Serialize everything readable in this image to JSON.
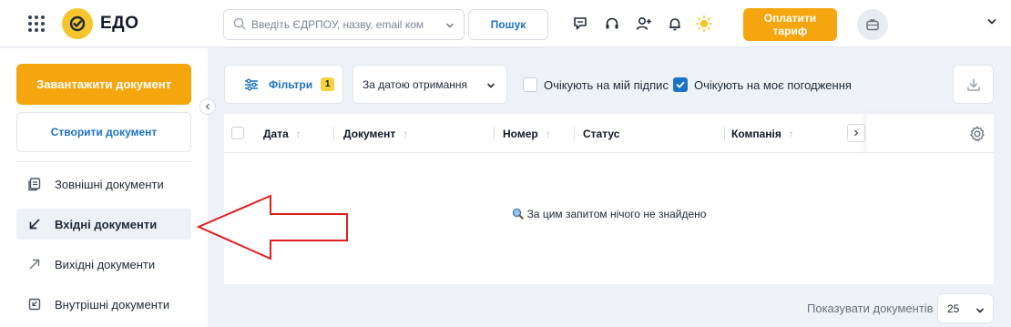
{
  "header": {
    "app_name": "ЕДО",
    "search": {
      "placeholder": "Введіть ЄДРПОУ, назву, email ком",
      "button_label": "Пошук"
    },
    "pay_button_label": "Оплатити\nтариф",
    "icons": [
      "apps-grid-icon",
      "chat-icon",
      "headset-icon",
      "add-user-icon",
      "bell-icon",
      "sun-icon",
      "briefcase-icon",
      "chevron-down-icon"
    ]
  },
  "sidebar": {
    "upload_button_label": "Завантажити документ",
    "create_button_label": "Створити документ",
    "items": [
      {
        "label": "Зовнішні документи",
        "icon": "external-docs-icon",
        "active": false
      },
      {
        "label": "Вхідні документи",
        "icon": "arrow-down-left-icon",
        "active": true
      },
      {
        "label": "Вихідні документи",
        "icon": "arrow-up-right-icon",
        "active": false
      },
      {
        "label": "Внутрішні документи",
        "icon": "internal-docs-icon",
        "active": false
      }
    ]
  },
  "toolbar": {
    "filters_label": "Фільтри",
    "filters_count": "1",
    "sort_value": "За датою отримання",
    "checkboxes": [
      {
        "label": "Очікують на мій підпис",
        "checked": false
      },
      {
        "label": "Очікують на моє погодження",
        "checked": true
      }
    ]
  },
  "table": {
    "columns": [
      "Дата",
      "Документ",
      "Номер",
      "Статус",
      "Компанія"
    ],
    "empty_message": "За цим запитом нічого не знайдено"
  },
  "footer": {
    "page_size_label": "Показувати документів",
    "page_size_value": "25"
  },
  "colors": {
    "accent_orange": "#f5a60f",
    "link_blue": "#1a73c8",
    "logo_yellow": "#f6c62c",
    "annotation_red": "#e11d1d"
  }
}
